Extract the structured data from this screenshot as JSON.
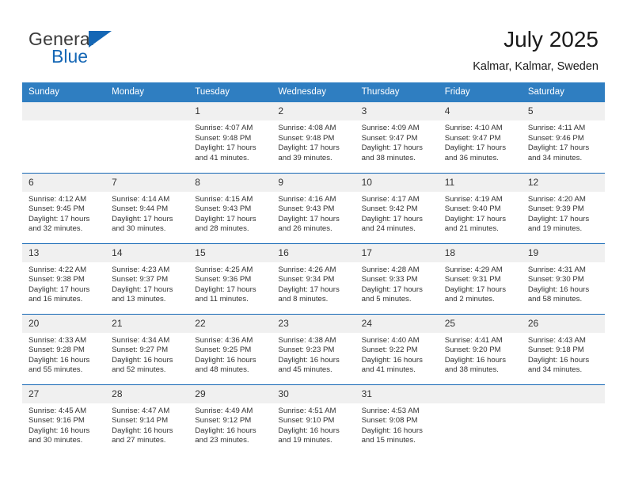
{
  "brand": {
    "name_top": "General",
    "name_bottom": "Blue",
    "triangle_color": "#1567b5",
    "text_color": "#3b3b3b"
  },
  "header": {
    "month_title": "July 2025",
    "location": "Kalmar, Kalmar, Sweden"
  },
  "colors": {
    "header_bg": "#2f7ec1",
    "row_border": "#1567b5",
    "daynum_bg": "#f0f0f0",
    "text": "#333333"
  },
  "weekdays": [
    "Sunday",
    "Monday",
    "Tuesday",
    "Wednesday",
    "Thursday",
    "Friday",
    "Saturday"
  ],
  "weeks": [
    [
      {
        "day": "",
        "sunrise": "",
        "sunset": "",
        "daylight1": "",
        "daylight2": ""
      },
      {
        "day": "",
        "sunrise": "",
        "sunset": "",
        "daylight1": "",
        "daylight2": ""
      },
      {
        "day": "1",
        "sunrise": "Sunrise: 4:07 AM",
        "sunset": "Sunset: 9:48 PM",
        "daylight1": "Daylight: 17 hours",
        "daylight2": "and 41 minutes."
      },
      {
        "day": "2",
        "sunrise": "Sunrise: 4:08 AM",
        "sunset": "Sunset: 9:48 PM",
        "daylight1": "Daylight: 17 hours",
        "daylight2": "and 39 minutes."
      },
      {
        "day": "3",
        "sunrise": "Sunrise: 4:09 AM",
        "sunset": "Sunset: 9:47 PM",
        "daylight1": "Daylight: 17 hours",
        "daylight2": "and 38 minutes."
      },
      {
        "day": "4",
        "sunrise": "Sunrise: 4:10 AM",
        "sunset": "Sunset: 9:47 PM",
        "daylight1": "Daylight: 17 hours",
        "daylight2": "and 36 minutes."
      },
      {
        "day": "5",
        "sunrise": "Sunrise: 4:11 AM",
        "sunset": "Sunset: 9:46 PM",
        "daylight1": "Daylight: 17 hours",
        "daylight2": "and 34 minutes."
      }
    ],
    [
      {
        "day": "6",
        "sunrise": "Sunrise: 4:12 AM",
        "sunset": "Sunset: 9:45 PM",
        "daylight1": "Daylight: 17 hours",
        "daylight2": "and 32 minutes."
      },
      {
        "day": "7",
        "sunrise": "Sunrise: 4:14 AM",
        "sunset": "Sunset: 9:44 PM",
        "daylight1": "Daylight: 17 hours",
        "daylight2": "and 30 minutes."
      },
      {
        "day": "8",
        "sunrise": "Sunrise: 4:15 AM",
        "sunset": "Sunset: 9:43 PM",
        "daylight1": "Daylight: 17 hours",
        "daylight2": "and 28 minutes."
      },
      {
        "day": "9",
        "sunrise": "Sunrise: 4:16 AM",
        "sunset": "Sunset: 9:43 PM",
        "daylight1": "Daylight: 17 hours",
        "daylight2": "and 26 minutes."
      },
      {
        "day": "10",
        "sunrise": "Sunrise: 4:17 AM",
        "sunset": "Sunset: 9:42 PM",
        "daylight1": "Daylight: 17 hours",
        "daylight2": "and 24 minutes."
      },
      {
        "day": "11",
        "sunrise": "Sunrise: 4:19 AM",
        "sunset": "Sunset: 9:40 PM",
        "daylight1": "Daylight: 17 hours",
        "daylight2": "and 21 minutes."
      },
      {
        "day": "12",
        "sunrise": "Sunrise: 4:20 AM",
        "sunset": "Sunset: 9:39 PM",
        "daylight1": "Daylight: 17 hours",
        "daylight2": "and 19 minutes."
      }
    ],
    [
      {
        "day": "13",
        "sunrise": "Sunrise: 4:22 AM",
        "sunset": "Sunset: 9:38 PM",
        "daylight1": "Daylight: 17 hours",
        "daylight2": "and 16 minutes."
      },
      {
        "day": "14",
        "sunrise": "Sunrise: 4:23 AM",
        "sunset": "Sunset: 9:37 PM",
        "daylight1": "Daylight: 17 hours",
        "daylight2": "and 13 minutes."
      },
      {
        "day": "15",
        "sunrise": "Sunrise: 4:25 AM",
        "sunset": "Sunset: 9:36 PM",
        "daylight1": "Daylight: 17 hours",
        "daylight2": "and 11 minutes."
      },
      {
        "day": "16",
        "sunrise": "Sunrise: 4:26 AM",
        "sunset": "Sunset: 9:34 PM",
        "daylight1": "Daylight: 17 hours",
        "daylight2": "and 8 minutes."
      },
      {
        "day": "17",
        "sunrise": "Sunrise: 4:28 AM",
        "sunset": "Sunset: 9:33 PM",
        "daylight1": "Daylight: 17 hours",
        "daylight2": "and 5 minutes."
      },
      {
        "day": "18",
        "sunrise": "Sunrise: 4:29 AM",
        "sunset": "Sunset: 9:31 PM",
        "daylight1": "Daylight: 17 hours",
        "daylight2": "and 2 minutes."
      },
      {
        "day": "19",
        "sunrise": "Sunrise: 4:31 AM",
        "sunset": "Sunset: 9:30 PM",
        "daylight1": "Daylight: 16 hours",
        "daylight2": "and 58 minutes."
      }
    ],
    [
      {
        "day": "20",
        "sunrise": "Sunrise: 4:33 AM",
        "sunset": "Sunset: 9:28 PM",
        "daylight1": "Daylight: 16 hours",
        "daylight2": "and 55 minutes."
      },
      {
        "day": "21",
        "sunrise": "Sunrise: 4:34 AM",
        "sunset": "Sunset: 9:27 PM",
        "daylight1": "Daylight: 16 hours",
        "daylight2": "and 52 minutes."
      },
      {
        "day": "22",
        "sunrise": "Sunrise: 4:36 AM",
        "sunset": "Sunset: 9:25 PM",
        "daylight1": "Daylight: 16 hours",
        "daylight2": "and 48 minutes."
      },
      {
        "day": "23",
        "sunrise": "Sunrise: 4:38 AM",
        "sunset": "Sunset: 9:23 PM",
        "daylight1": "Daylight: 16 hours",
        "daylight2": "and 45 minutes."
      },
      {
        "day": "24",
        "sunrise": "Sunrise: 4:40 AM",
        "sunset": "Sunset: 9:22 PM",
        "daylight1": "Daylight: 16 hours",
        "daylight2": "and 41 minutes."
      },
      {
        "day": "25",
        "sunrise": "Sunrise: 4:41 AM",
        "sunset": "Sunset: 9:20 PM",
        "daylight1": "Daylight: 16 hours",
        "daylight2": "and 38 minutes."
      },
      {
        "day": "26",
        "sunrise": "Sunrise: 4:43 AM",
        "sunset": "Sunset: 9:18 PM",
        "daylight1": "Daylight: 16 hours",
        "daylight2": "and 34 minutes."
      }
    ],
    [
      {
        "day": "27",
        "sunrise": "Sunrise: 4:45 AM",
        "sunset": "Sunset: 9:16 PM",
        "daylight1": "Daylight: 16 hours",
        "daylight2": "and 30 minutes."
      },
      {
        "day": "28",
        "sunrise": "Sunrise: 4:47 AM",
        "sunset": "Sunset: 9:14 PM",
        "daylight1": "Daylight: 16 hours",
        "daylight2": "and 27 minutes."
      },
      {
        "day": "29",
        "sunrise": "Sunrise: 4:49 AM",
        "sunset": "Sunset: 9:12 PM",
        "daylight1": "Daylight: 16 hours",
        "daylight2": "and 23 minutes."
      },
      {
        "day": "30",
        "sunrise": "Sunrise: 4:51 AM",
        "sunset": "Sunset: 9:10 PM",
        "daylight1": "Daylight: 16 hours",
        "daylight2": "and 19 minutes."
      },
      {
        "day": "31",
        "sunrise": "Sunrise: 4:53 AM",
        "sunset": "Sunset: 9:08 PM",
        "daylight1": "Daylight: 16 hours",
        "daylight2": "and 15 minutes."
      },
      {
        "day": "",
        "sunrise": "",
        "sunset": "",
        "daylight1": "",
        "daylight2": ""
      },
      {
        "day": "",
        "sunrise": "",
        "sunset": "",
        "daylight1": "",
        "daylight2": ""
      }
    ]
  ]
}
